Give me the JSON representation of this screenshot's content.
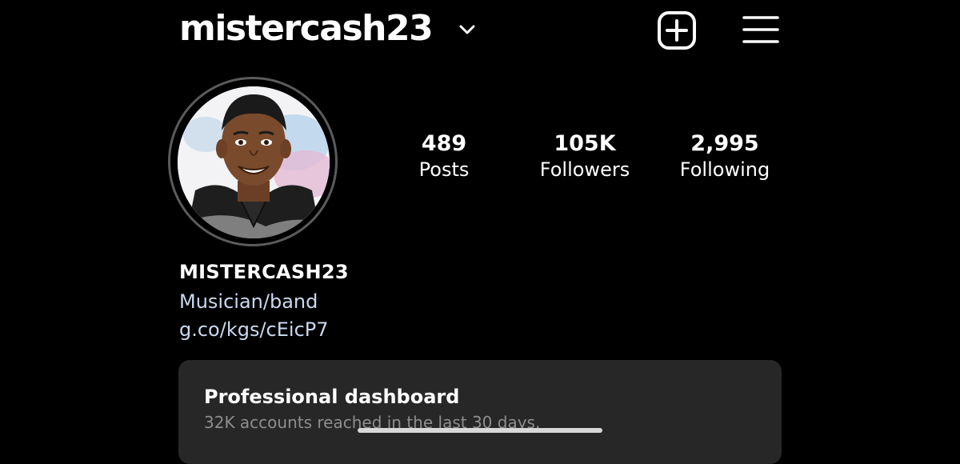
{
  "header": {
    "username": "mistercash23"
  },
  "stats": [
    {
      "value": "489",
      "label": "Posts"
    },
    {
      "value": "105K",
      "label": "Followers"
    },
    {
      "value": "2,995",
      "label": "Following"
    }
  ],
  "bio": {
    "name": "MISTERCASH23",
    "category": "Musician/band",
    "link": "g.co/kgs/cEicP7"
  },
  "dashboard": {
    "title": "Professional dashboard",
    "subtitle": "32K accounts reached in the last 30 days."
  },
  "icons": {
    "account_switcher": "chevron-down-icon",
    "create": "plus-square-icon",
    "menu": "hamburger-menu-icon"
  }
}
